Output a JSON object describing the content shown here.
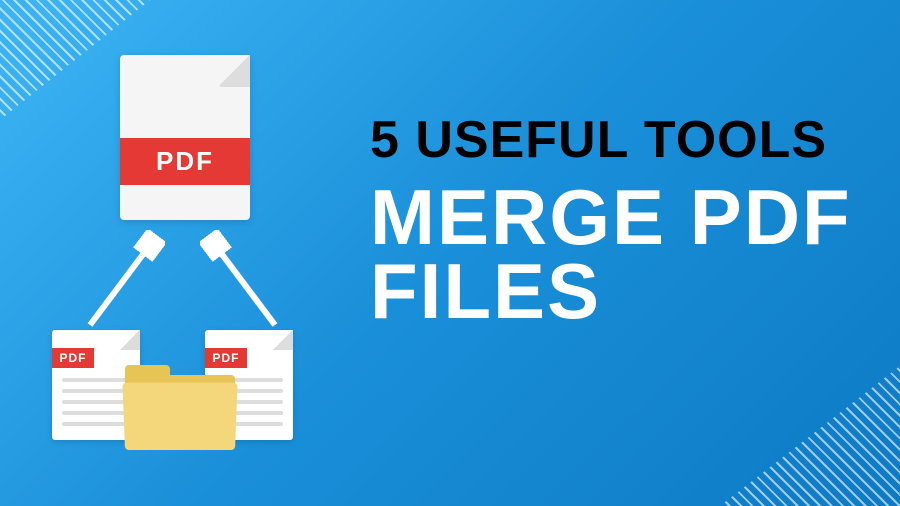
{
  "headline": "5 Useful Tools",
  "subtitle_line1": "Merge PDF",
  "subtitle_line2": "Files",
  "pdf_label_large": "PDF",
  "pdf_label_small": "PDF",
  "colors": {
    "accent_red": "#e53935",
    "bg_gradient_start": "#3db5f5",
    "bg_gradient_end": "#0d7ac4",
    "folder_front": "#f4d77a",
    "folder_back": "#e6c456"
  }
}
